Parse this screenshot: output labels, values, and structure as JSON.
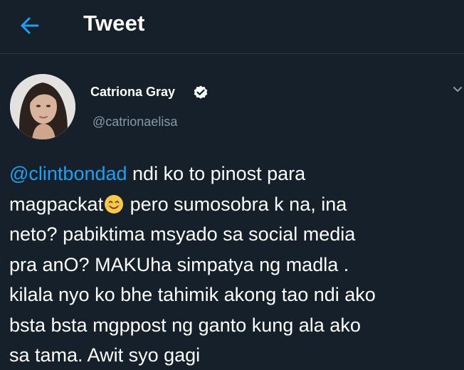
{
  "header": {
    "title": "Tweet",
    "back_icon": "arrow-left-icon"
  },
  "author": {
    "name": "Catriona Gray",
    "handle": "@catrionaelisa",
    "verified_icon": "verified-badge-icon",
    "avatar": "profile-photo"
  },
  "tweet": {
    "mention": "@clintbondad",
    "line1_rest": " ndi ko to pinost para",
    "line2_a": "magpackat",
    "emoji_icon": "smiling-face-emoji",
    "line2_b": " pero sumosobra k na, ina",
    "line3": "neto? pabiktima msyado sa social media",
    "line4": "pra anO? MAKUha simpatya ng madla .",
    "line5": "kilala nyo ko bhe tahimik akong tao ndi ako",
    "line6": "bsta bsta mgppost ng ganto kung ala ako",
    "line7": "sa tama. Awit syo gagi"
  },
  "colors": {
    "background": "#15202b",
    "link": "#1da1f2",
    "secondary_text": "#8899a6",
    "divider": "#2a3641"
  }
}
